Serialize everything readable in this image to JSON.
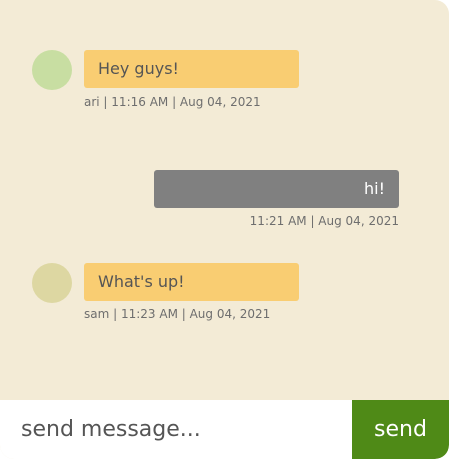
{
  "messages": [
    {
      "sender": "ari",
      "text": "Hey guys!",
      "meta": "ari | 11:16 AM | Aug 04, 2021",
      "side": "left",
      "avatar_color": "#c8dea2"
    },
    {
      "sender": "",
      "text": "hi!",
      "meta": "11:21 AM | Aug 04, 2021",
      "side": "right"
    },
    {
      "sender": "sam",
      "text": "What's up!",
      "meta": "sam | 11:23 AM | Aug 04, 2021",
      "side": "left",
      "avatar_color": "#ddd7a2"
    }
  ],
  "composer": {
    "placeholder": "send message...",
    "value": "",
    "send_label": "send"
  },
  "colors": {
    "background": "#f3ebd6",
    "incoming_bubble": "#f9cd72",
    "outgoing_bubble": "#808080",
    "send_button": "#4f8a17"
  }
}
